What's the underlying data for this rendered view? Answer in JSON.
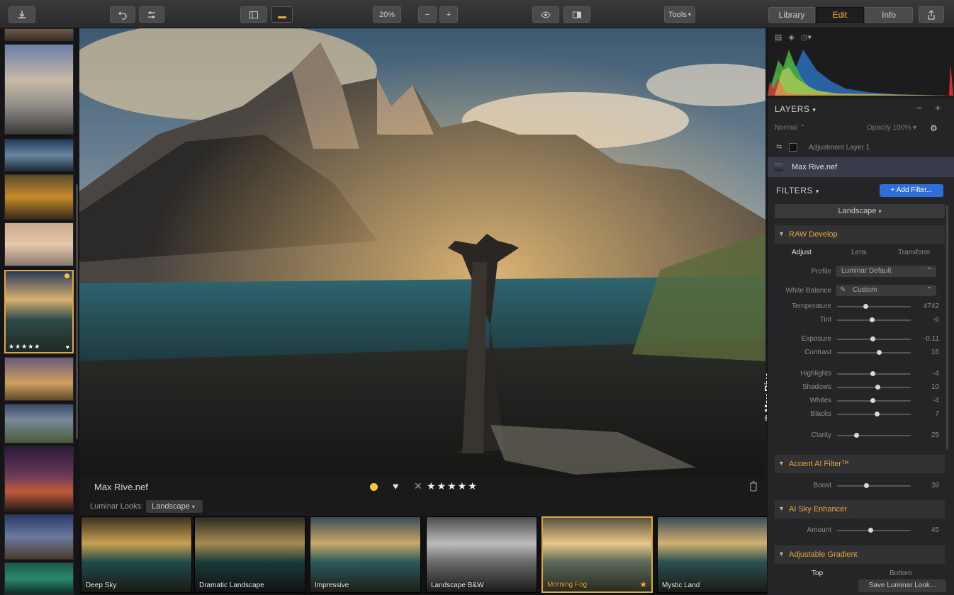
{
  "toolbar": {
    "zoom": "20%",
    "tools_label": "Tools",
    "tabs": [
      {
        "label": "Library"
      },
      {
        "label": "Edit"
      },
      {
        "label": "Info"
      }
    ]
  },
  "filmstrip": {
    "selected_rating": "★★★★★"
  },
  "image": {
    "filename": "Max Rive.nef",
    "color_label": "#f5c542",
    "rating": "★★★★★",
    "copyright": "© Max Rive"
  },
  "looks": {
    "label": "Luminar Looks:",
    "selected": "Landscape",
    "items": [
      {
        "name": "Deep Sky"
      },
      {
        "name": "Dramatic Landscape"
      },
      {
        "name": "Impressive"
      },
      {
        "name": "Landscape B&W"
      },
      {
        "name": "Morning Fog"
      },
      {
        "name": "Mystic Land"
      }
    ]
  },
  "panel": {
    "layers": {
      "title": "LAYERS",
      "blend_mode": "Normal",
      "opacity": "Opacity 100%",
      "items": [
        {
          "name": "Adjustment Layer 1"
        },
        {
          "name": "Max Rive.nef"
        }
      ]
    },
    "filters": {
      "title": "FILTERS",
      "add_button": "+ Add Filter...",
      "workspace": "Landscape",
      "raw_develop": {
        "title": "RAW Develop",
        "tabs": [
          "Adjust",
          "Lens",
          "Transform"
        ],
        "profile_label": "Profile",
        "profile_value": "Luminar Default",
        "wb_label": "White Balance",
        "wb_value": "Custom",
        "sliders": [
          {
            "label": "Temperature",
            "value": "4742",
            "pos": 0.38
          },
          {
            "label": "Tint",
            "value": "-6",
            "pos": 0.47
          },
          {
            "label": "Exposure",
            "value": "-0.11",
            "pos": 0.48
          },
          {
            "label": "Contrast",
            "value": "16",
            "pos": 0.57
          },
          {
            "label": "Highlights",
            "value": "-4",
            "pos": 0.48
          },
          {
            "label": "Shadows",
            "value": "10",
            "pos": 0.55
          },
          {
            "label": "Whites",
            "value": "-4",
            "pos": 0.48
          },
          {
            "label": "Blacks",
            "value": "7",
            "pos": 0.54
          },
          {
            "label": "Clarity",
            "value": "25",
            "pos": 0.26
          }
        ]
      },
      "accent": {
        "title": "Accent AI Filter™",
        "label": "Boost",
        "value": "39",
        "pos": 0.39
      },
      "sky": {
        "title": "AI Sky Enhancer",
        "label": "Amount",
        "value": "45",
        "pos": 0.45
      },
      "gradient": {
        "title": "Adjustable Gradient",
        "tabs": [
          "Top",
          "Bottom"
        ]
      },
      "save_button": "Save Luminar Look..."
    }
  }
}
